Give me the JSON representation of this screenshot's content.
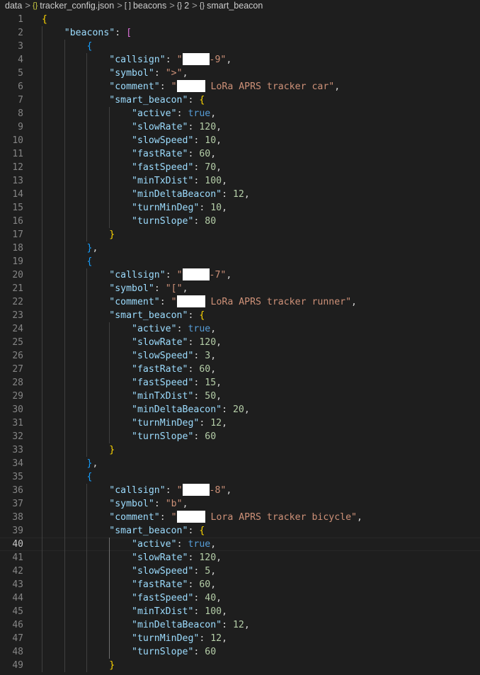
{
  "breadcrumb": {
    "root": "data",
    "file": "tracker_config.json",
    "file_icon": "{}",
    "array": "beacons",
    "array_icon": "[ ]",
    "index": "2",
    "index_icon": "{}",
    "object": "smart_beacon",
    "object_icon": "{}",
    "separator": ">"
  },
  "editor": {
    "current_line": 40,
    "beacons": [
      {
        "callsign_suffix": "-9",
        "symbol": ">",
        "comment_suffix": " LoRa APRS tracker car",
        "smart_beacon": {
          "active": "true",
          "slowRate": "120",
          "slowSpeed": "10",
          "fastRate": "60",
          "fastSpeed": "70",
          "minTxDist": "100",
          "minDeltaBeacon": "12",
          "turnMinDeg": "10",
          "turnSlope": "80"
        }
      },
      {
        "callsign_suffix": "-7",
        "symbol": "[",
        "comment_suffix": " LoRa APRS tracker runner",
        "smart_beacon": {
          "active": "true",
          "slowRate": "120",
          "slowSpeed": "3",
          "fastRate": "60",
          "fastSpeed": "15",
          "minTxDist": "50",
          "minDeltaBeacon": "20",
          "turnMinDeg": "12",
          "turnSlope": "60"
        }
      },
      {
        "callsign_suffix": "-8",
        "symbol": "b",
        "comment_suffix": " Lora APRS tracker bicycle",
        "smart_beacon": {
          "active": "true",
          "slowRate": "120",
          "slowSpeed": "5",
          "fastRate": "60",
          "fastSpeed": "40",
          "minTxDist": "100",
          "minDeltaBeacon": "12",
          "turnMinDeg": "12",
          "turnSlope": "60"
        }
      }
    ]
  }
}
